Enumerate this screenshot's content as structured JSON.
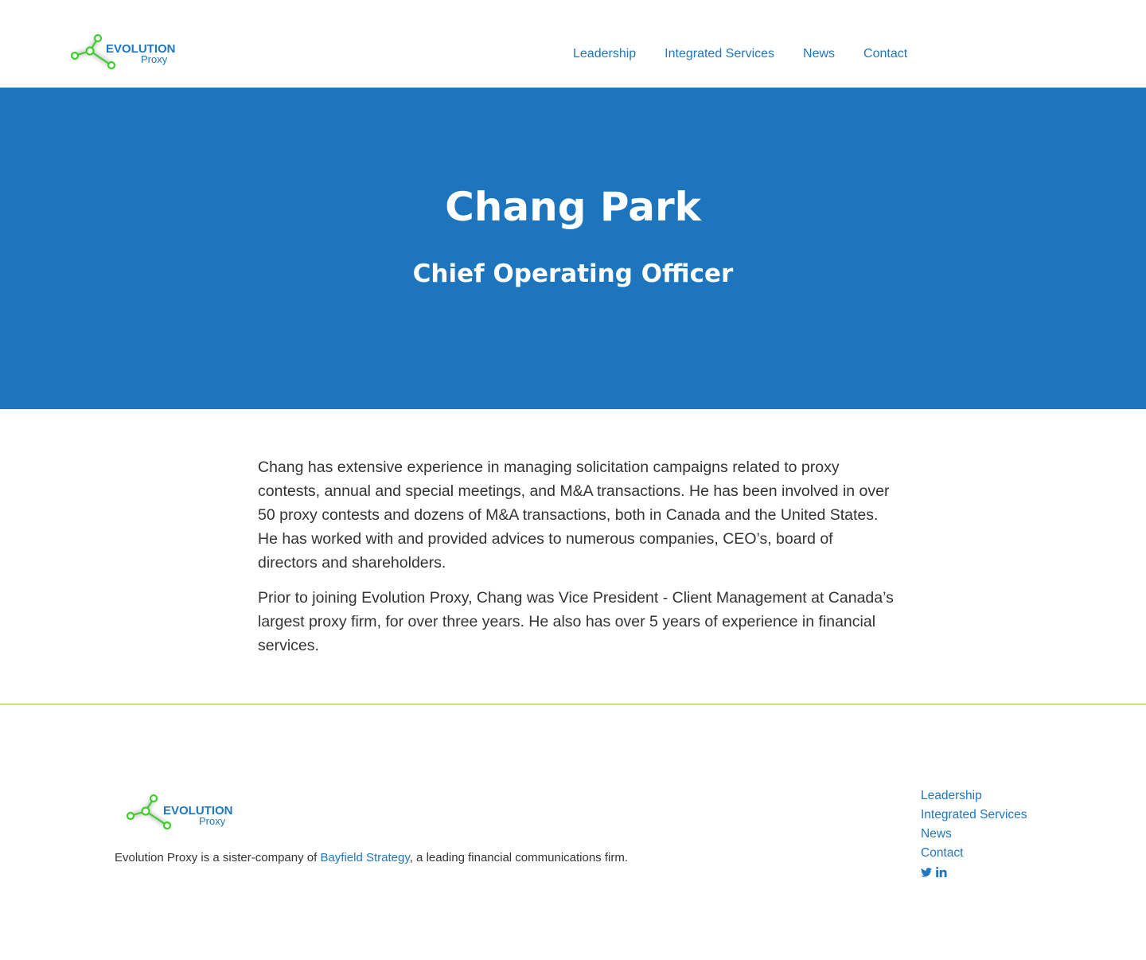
{
  "header": {
    "logo": {
      "line1": "EVOLUTION",
      "line2": "Proxy"
    },
    "nav": [
      "Leadership",
      "Integrated Services",
      "News",
      "Contact"
    ]
  },
  "hero": {
    "name": "Chang Park",
    "title": "Chief Operating Officer"
  },
  "bio": {
    "paragraphs": [
      "Chang has extensive experience in managing solicitation campaigns related to proxy contests, annual and special meetings, and M&A transactions. He has been involved in over 50 proxy contests and dozens of M&A transactions, both in Canada and the United States. He has worked with and provided advices to numerous companies, CEO’s, board of directors and shareholders.",
      "Prior to joining Evolution Proxy, Chang was Vice President - Client Management at Canada’s largest proxy firm, for over three years. He also has over 5 years of experience in financial services."
    ]
  },
  "footer": {
    "logo": {
      "line1": "EVOLUTION",
      "line2": "Proxy"
    },
    "sister_prefix": "Evolution Proxy is a sister-company of ",
    "sister_link": "Bayfield Strategy",
    "sister_suffix": ", a leading financial communications firm.",
    "nav": [
      "Leadership",
      "Integrated Services",
      "News",
      "Contact"
    ],
    "social": [
      "twitter-icon",
      "linkedin-icon"
    ]
  },
  "colors": {
    "brand_blue": "#1d76bd",
    "link_blue": "#1f77c0",
    "green": "#3dcf2b",
    "divider_green": "#8dc63f"
  }
}
